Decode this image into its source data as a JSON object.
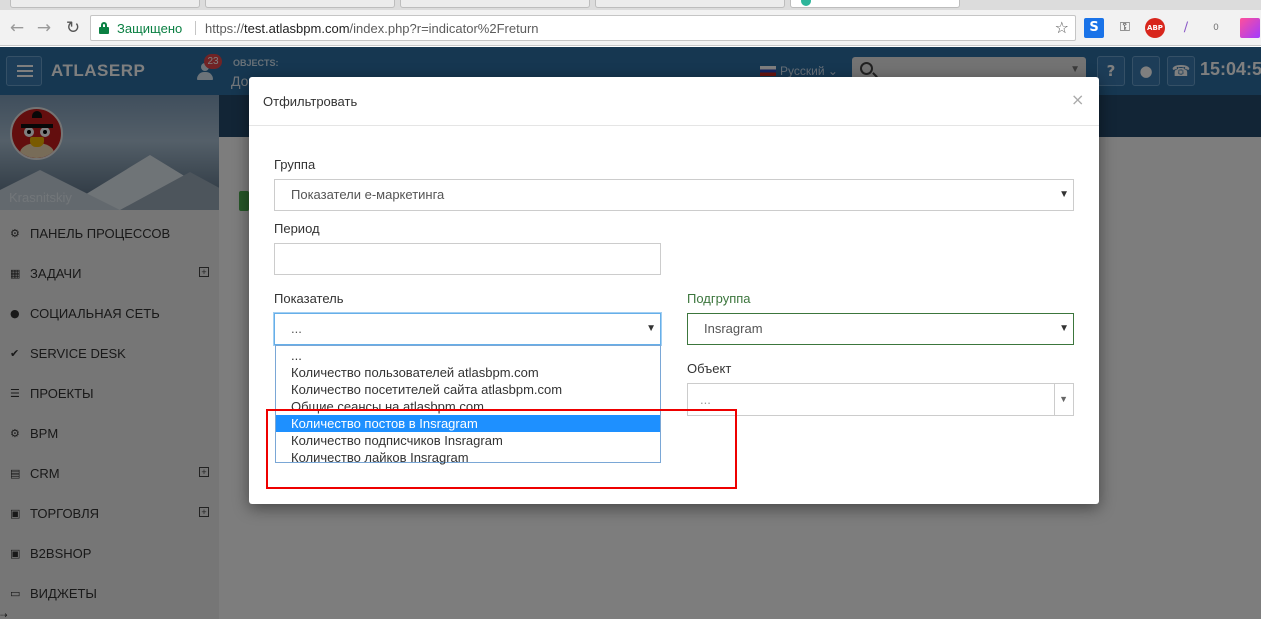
{
  "browser": {
    "secure_label": "Защищено",
    "url_scheme": "https://",
    "url_host": "test.atlasbpm.com",
    "url_path": "/index.php?r=indicator%2Freturn",
    "extensions": [
      "S",
      "ABP",
      "0"
    ]
  },
  "header": {
    "brand": "ATLASERP",
    "notifications_count": "23",
    "objects_label": "OBJECTS:",
    "objects_value": "До",
    "language": "Русский",
    "clock": "15:04:5"
  },
  "sidebar": {
    "username": "Krasnitskiy",
    "items": [
      {
        "label": "ПАНЕЛЬ ПРОЦЕССОВ",
        "icon": "dashboard-icon",
        "glyph": "⚙",
        "expandable": false
      },
      {
        "label": "ЗАДАЧИ",
        "icon": "calendar-icon",
        "glyph": "▦",
        "expandable": true
      },
      {
        "label": "СОЦИАЛЬНАЯ СЕТЬ",
        "icon": "comments-icon",
        "glyph": "●",
        "expandable": false
      },
      {
        "label": "SERVICE DESK",
        "icon": "check-icon",
        "glyph": "✔",
        "expandable": false
      },
      {
        "label": "ПРОЕКТЫ",
        "icon": "list-icon",
        "glyph": "☰",
        "expandable": false
      },
      {
        "label": "BPM",
        "icon": "cogs-icon",
        "glyph": "⚙",
        "expandable": false
      },
      {
        "label": "CRM",
        "icon": "book-icon",
        "glyph": "▤",
        "expandable": true
      },
      {
        "label": "ТОРГОВЛЯ",
        "icon": "money-icon",
        "glyph": "▣",
        "expandable": true
      },
      {
        "label": "B2BSHOP",
        "icon": "money-icon",
        "glyph": "▣",
        "expandable": false
      },
      {
        "label": "ВИДЖЕТЫ",
        "icon": "desktop-icon",
        "glyph": "▭",
        "expandable": false
      }
    ]
  },
  "modal": {
    "title": "Отфильтровать",
    "close": "×",
    "group_label": "Группа",
    "group_value": "Показатели е-маркетинга",
    "period_label": "Период",
    "period_value": "",
    "indicator_label": "Показатель",
    "indicator_value": "...",
    "subgroup_label": "Подгруппа",
    "subgroup_value": "Insragram",
    "object_label": "Объект",
    "object_value": "...",
    "indicator_options": [
      "...",
      "Количество пользователей atlasbpm.com",
      "Количество посетителей сайта atlasbpm.com",
      "Общие сеансы на atlasbpm.com",
      "Количество постов в Insragram",
      "Количество подписчиков Insragram",
      "Количество лайков Insragram"
    ],
    "indicator_selected_index": 4
  },
  "colors": {
    "header_blue": "#2c6fa3",
    "highlight_red": "#e00000",
    "option_selected": "#1e90ff",
    "valid_green": "#3c763d"
  }
}
